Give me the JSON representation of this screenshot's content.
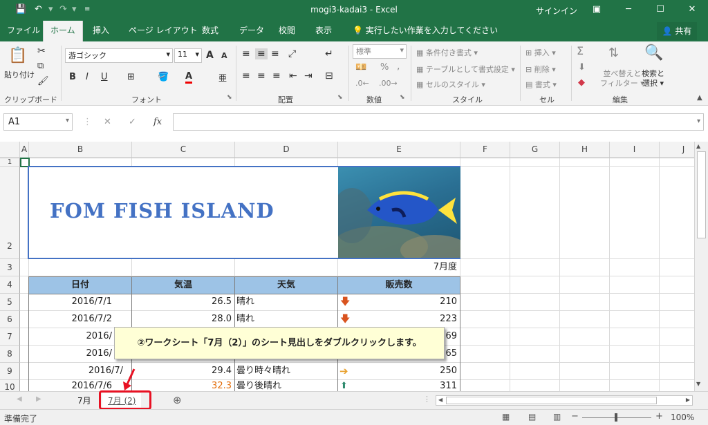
{
  "titlebar": {
    "title": "mogi3-kadai3  -  Excel",
    "signin": "サインイン"
  },
  "tabs": [
    "ファイル",
    "ホーム",
    "挿入",
    "ページ レイアウト",
    "数式",
    "データ",
    "校閲",
    "表示"
  ],
  "tell_me": "実行したい作業を入力してください",
  "share": "共有",
  "ribbon": {
    "clipboard": {
      "paste": "貼り付け",
      "label": "クリップボード"
    },
    "font": {
      "name": "游ゴシック",
      "size": "11",
      "bold": "B",
      "italic": "I",
      "underline": "U",
      "grow": "A",
      "shrink": "A",
      "label": "フォント"
    },
    "alignment": {
      "label": "配置"
    },
    "number": {
      "format": "標準",
      "percent": "%",
      "comma": ",",
      "label": "数値"
    },
    "styles": {
      "conditional": "条件付き書式",
      "as_table": "テーブルとして書式設定",
      "cell_style": "セルのスタイル",
      "label": "スタイル"
    },
    "cells": {
      "insert": "挿入",
      "delete": "削除",
      "format": "書式",
      "label": "セル"
    },
    "editing": {
      "sort": "並べ替えと",
      "filter": "フィルター",
      "find": "検索と",
      "select": "選択",
      "sigma": "Σ",
      "label": "編集"
    }
  },
  "formula_bar": {
    "name_box": "A1",
    "fx": "fx",
    "formula": ""
  },
  "columns": [
    "A",
    "B",
    "C",
    "D",
    "E",
    "F",
    "G",
    "H",
    "I",
    "J"
  ],
  "rows": [
    "1",
    "2",
    "3",
    "4",
    "5",
    "6",
    "7",
    "8",
    "9",
    "10"
  ],
  "sheet": {
    "banner_title": "FOM FISH ISLAND",
    "month_label": "7月度",
    "headers": [
      "日付",
      "気温",
      "天気",
      "販売数"
    ],
    "data": [
      {
        "date": "2016/7/1",
        "temp": "26.5",
        "weather": "晴れ",
        "sales": "210",
        "arrow": "down"
      },
      {
        "date": "2016/7/2",
        "temp": "28.0",
        "weather": "晴れ",
        "sales": "223",
        "arrow": "down"
      },
      {
        "date": "2016/",
        "temp": "",
        "weather": "",
        "sales": "69",
        "arrow": ""
      },
      {
        "date": "2016/",
        "temp": "",
        "weather": "",
        "sales": "65",
        "arrow": ""
      },
      {
        "date": "2016/7/",
        "temp": "29.4",
        "weather": "曇り時々晴れ",
        "sales": "250",
        "arrow": "right"
      },
      {
        "date": "2016/7/6",
        "temp": "32.3",
        "weather": "曇り後晴れ",
        "sales": "311",
        "arrow": "up"
      }
    ]
  },
  "callout": "②ワークシート「7月（2）」のシート見出しをダブルクリックします。",
  "sheet_tabs": [
    "7月",
    "7月 (2)"
  ],
  "status": {
    "ready": "準備完了",
    "zoom": "100%"
  },
  "colors": {
    "excel_green": "#217346",
    "header_blue": "#9dc3e6",
    "callout_red": "#e81123"
  }
}
